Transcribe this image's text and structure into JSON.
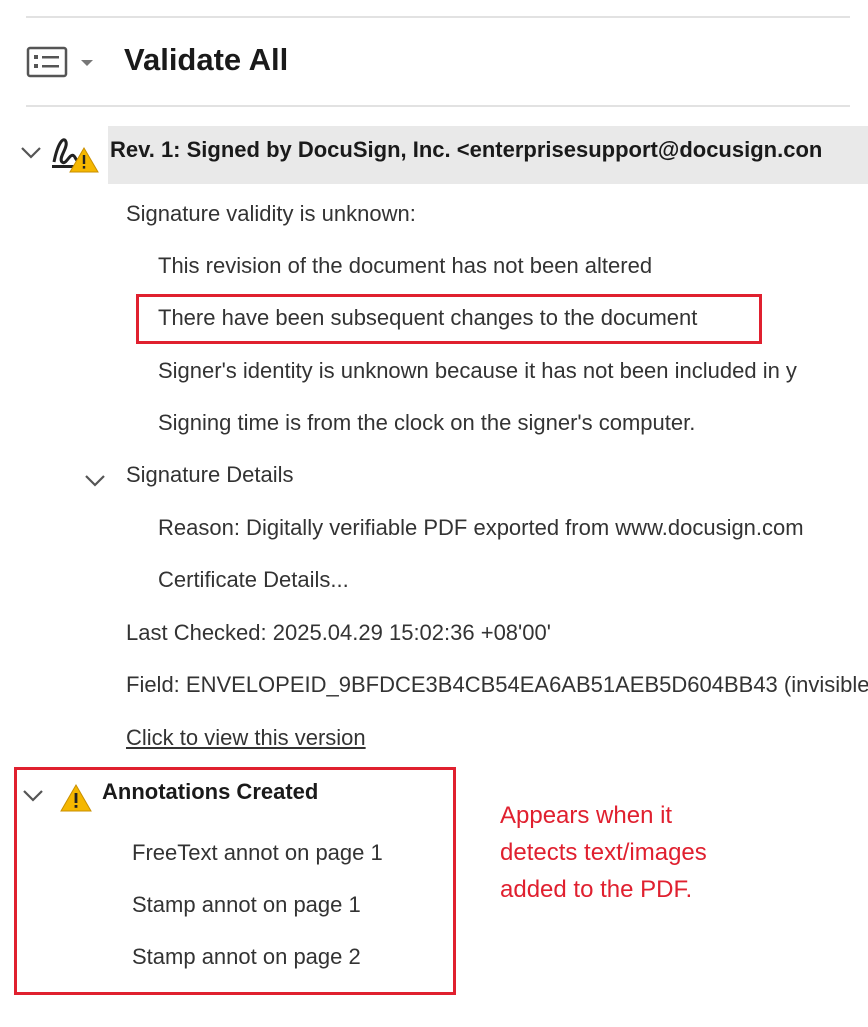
{
  "toolbar": {
    "icon": "list-view-icon",
    "title": "Validate All"
  },
  "revision": {
    "label": "Rev. 1: Signed by DocuSign, Inc. <enterprisesupport@docusign.con",
    "icon": "signature-warning-icon"
  },
  "validity": {
    "heading": "Signature validity is unknown:",
    "items": [
      "This revision of the document has not been altered",
      "There have been subsequent changes to the document",
      "Signer's identity is unknown because it has not been included in y",
      "Signing time is from the clock on the signer's computer."
    ]
  },
  "details": {
    "heading": "Signature Details",
    "reason": "Reason: Digitally verifiable PDF exported from www.docusign.com",
    "certificate": "Certificate Details..."
  },
  "last_checked": "Last Checked: 2025.04.29 15:02:36 +08'00'",
  "field": "Field: ENVELOPEID_9BFDCE3B4CB54EA6AB51AEB5D604BB43 (invisible",
  "view_version_link": "Click to view this version",
  "annotations": {
    "heading": "Annotations Created",
    "items": [
      "FreeText annot on page 1",
      "Stamp annot on page 1",
      "Stamp annot on page 2"
    ]
  },
  "callout": {
    "lines": [
      "Appears when it",
      "detects text/images",
      "added to the PDF."
    ]
  },
  "colors": {
    "highlight_red": "#e0202f",
    "warning_yellow": "#f5b700",
    "row_selected": "#e9e9e9"
  }
}
